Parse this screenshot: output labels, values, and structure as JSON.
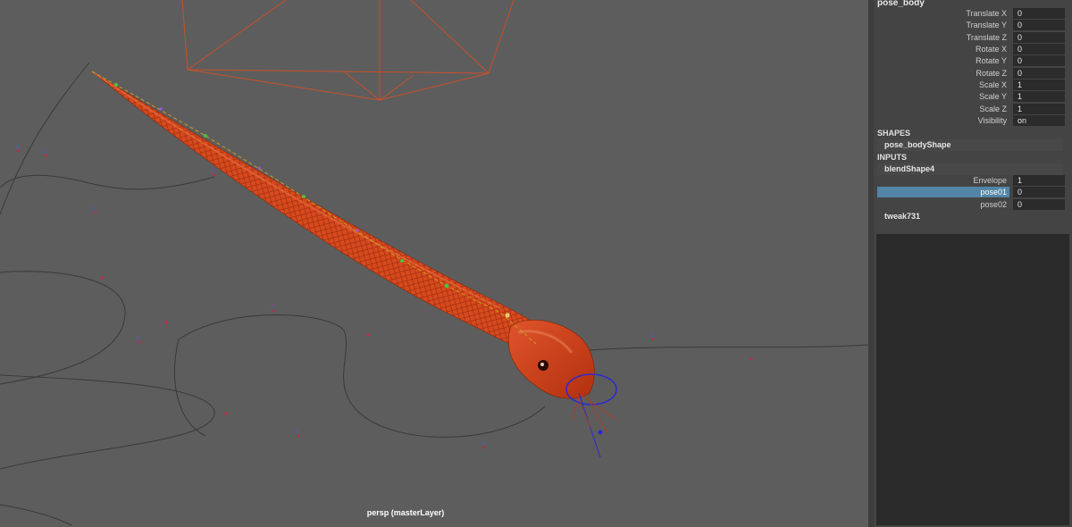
{
  "viewport": {
    "camera_label": "persp (masterLayer)"
  },
  "channel_box": {
    "node_name": "pose_body",
    "attributes": [
      {
        "label": "Translate X",
        "value": "0"
      },
      {
        "label": "Translate Y",
        "value": "0"
      },
      {
        "label": "Translate Z",
        "value": "0"
      },
      {
        "label": "Rotate X",
        "value": "0"
      },
      {
        "label": "Rotate Y",
        "value": "0"
      },
      {
        "label": "Rotate Z",
        "value": "0"
      },
      {
        "label": "Scale X",
        "value": "1"
      },
      {
        "label": "Scale Y",
        "value": "1"
      },
      {
        "label": "Scale Z",
        "value": "1"
      },
      {
        "label": "Visibility",
        "value": "on"
      }
    ],
    "shapes_header": "SHAPES",
    "shape_node": "pose_bodyShape",
    "inputs_header": "INPUTS",
    "input_node": "blendShape4",
    "input_attributes": [
      {
        "label": "Envelope",
        "value": "1"
      },
      {
        "label": "pose01",
        "value": "0",
        "selected": true
      },
      {
        "label": "pose02",
        "value": "0"
      }
    ],
    "tweak_node": "tweak731"
  },
  "colors": {
    "viewport_bg": "#5d5d5d",
    "snake_orange": "#d9481c",
    "selection_blue": "#5285a6",
    "camera_wire": "#c8502a"
  }
}
